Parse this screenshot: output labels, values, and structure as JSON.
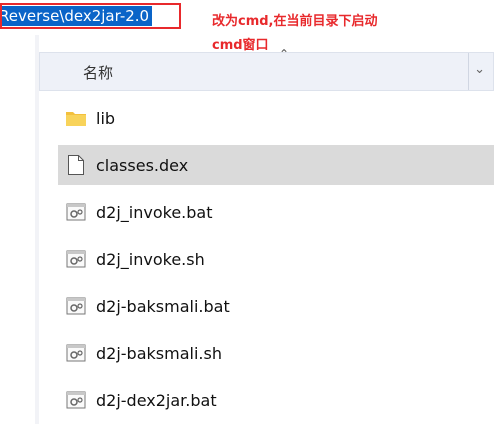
{
  "address_bar": {
    "path_text": "Reverse\\dex2jar-2.0"
  },
  "annotation": {
    "line1": "改为cmd,在当前目录下启动",
    "line2": "cmd窗口"
  },
  "header": {
    "column_name": "名称"
  },
  "files": [
    {
      "name": "lib",
      "icon": "folder-icon",
      "selected": false
    },
    {
      "name": "classes.dex",
      "icon": "file-icon",
      "selected": true
    },
    {
      "name": "d2j_invoke.bat",
      "icon": "batch-file-icon",
      "selected": false
    },
    {
      "name": "d2j_invoke.sh",
      "icon": "batch-file-icon",
      "selected": false
    },
    {
      "name": "d2j-baksmali.bat",
      "icon": "batch-file-icon",
      "selected": false
    },
    {
      "name": "d2j-baksmali.sh",
      "icon": "batch-file-icon",
      "selected": false
    },
    {
      "name": "d2j-dex2jar.bat",
      "icon": "batch-file-icon",
      "selected": false
    }
  ],
  "colors": {
    "annotation": "#e8292c",
    "selection": "#0a64c8",
    "row_selected": "#dadada"
  }
}
